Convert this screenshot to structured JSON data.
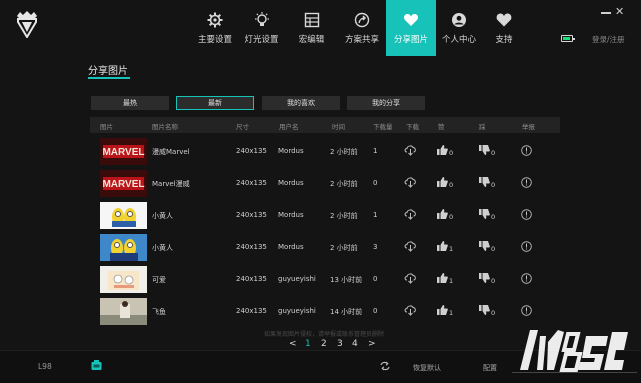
{
  "nav": {
    "items": [
      {
        "label": "主要设置",
        "icon": "gear-icon"
      },
      {
        "label": "灯光设置",
        "icon": "light-bulb-icon"
      },
      {
        "label": "宏编辑",
        "icon": "grid-icon"
      },
      {
        "label": "方案共享",
        "icon": "share-icon"
      },
      {
        "label": "分享图片",
        "icon": "heart-icon",
        "active": true
      },
      {
        "label": "个人中心",
        "icon": "user-icon"
      },
      {
        "label": "支持",
        "icon": "heart-support-icon"
      }
    ],
    "login": "登录/注册"
  },
  "page": {
    "title": "分享图片"
  },
  "filters": [
    "最热",
    "最新",
    "我的喜欢",
    "我的分享"
  ],
  "active_filter": "最新",
  "table": {
    "headers": [
      "图片",
      "图片名称",
      "尺寸",
      "用户名",
      "时间",
      "下载量",
      "下载",
      "赞",
      "踩",
      "举报"
    ],
    "rows": [
      {
        "name": "漫威Marvel",
        "size": "240x135",
        "user": "Mordus",
        "time": "2 小时前",
        "downloads": "1",
        "likes": "0",
        "dislikes": "0",
        "thumb": "marvel"
      },
      {
        "name": "Marvel漫威",
        "size": "240x135",
        "user": "Mordus",
        "time": "2 小时前",
        "downloads": "0",
        "likes": "0",
        "dislikes": "0",
        "thumb": "marvel"
      },
      {
        "name": "小黄人",
        "size": "240x135",
        "user": "Mordus",
        "time": "2 小时前",
        "downloads": "1",
        "likes": "0",
        "dislikes": "0",
        "thumb": "minion"
      },
      {
        "name": "小黄人",
        "size": "240x135",
        "user": "Mordus",
        "time": "2 小时前",
        "downloads": "3",
        "likes": "1",
        "dislikes": "0",
        "thumb": "minion-blue"
      },
      {
        "name": "可爱",
        "size": "240x135",
        "user": "guyueyishi",
        "time": "13 小时前",
        "downloads": "0",
        "likes": "1",
        "dislikes": "0",
        "thumb": "cute"
      },
      {
        "name": "飞鱼",
        "size": "240x135",
        "user": "guyueyishi",
        "time": "14 小时前",
        "downloads": "0",
        "likes": "1",
        "dislikes": "0",
        "thumb": "fish"
      }
    ]
  },
  "footer": {
    "note": "如果发现图片侵权，请举报或联系管理员删除",
    "pages": [
      "<",
      "1",
      "2",
      "3",
      "4",
      ">"
    ],
    "current_page": "1"
  },
  "bottom": {
    "model": "L98",
    "reset": "恢复默认",
    "config": "配置"
  },
  "colors": {
    "accent": "#17c3b9",
    "background": "#141414"
  }
}
